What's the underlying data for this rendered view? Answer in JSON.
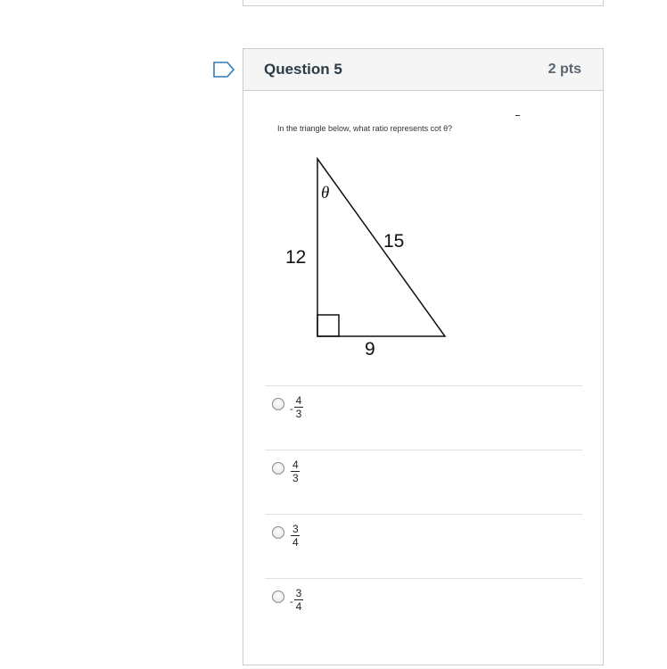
{
  "question": {
    "title": "Question 5",
    "points": "2 pts",
    "prompt": "In the triangle below, what ratio represents cot θ?"
  },
  "triangle": {
    "angle_label": "θ",
    "left_side": "12",
    "hypotenuse": "15",
    "bottom_side": "9"
  },
  "answers": [
    {
      "sign": "-",
      "numerator": "4",
      "denominator": "3"
    },
    {
      "sign": "",
      "numerator": "4",
      "denominator": "3"
    },
    {
      "sign": "",
      "numerator": "3",
      "denominator": "4"
    },
    {
      "sign": "-",
      "numerator": "3",
      "denominator": "4"
    }
  ],
  "colors": {
    "flag": "#2d7bb5",
    "border": "#c7cdd1",
    "header_bg": "#f5f5f5"
  }
}
